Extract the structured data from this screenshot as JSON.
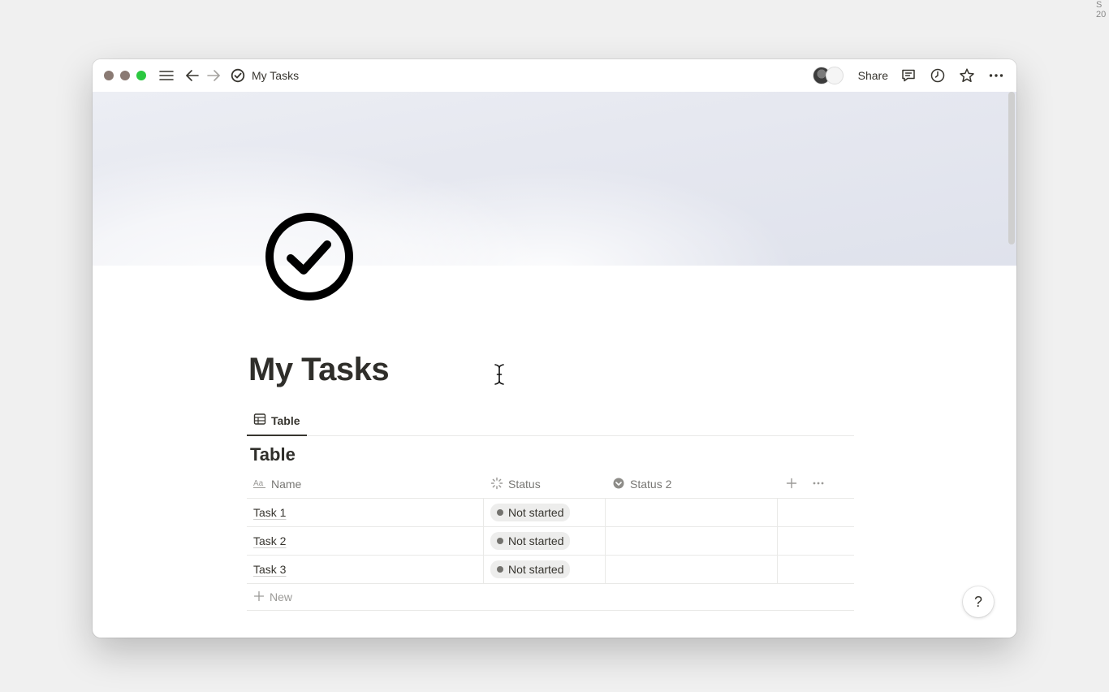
{
  "corner": {
    "text": "S 20"
  },
  "titlebar": {
    "breadcrumb": "My Tasks",
    "share_label": "Share"
  },
  "page": {
    "title": "My Tasks",
    "icon": "check-circle-icon"
  },
  "views": {
    "tabs": [
      {
        "label": "Table",
        "icon": "table-icon",
        "active": true
      }
    ]
  },
  "database": {
    "title": "Table",
    "columns": [
      {
        "label": "Name",
        "icon": "text-property-icon"
      },
      {
        "label": "Status",
        "icon": "status-loading-icon"
      },
      {
        "label": "Status 2",
        "icon": "status-circle-icon"
      }
    ],
    "rows": [
      {
        "name": "Task 1",
        "status": "Not started",
        "status2": ""
      },
      {
        "name": "Task 2",
        "status": "Not started",
        "status2": ""
      },
      {
        "name": "Task 3",
        "status": "Not started",
        "status2": ""
      }
    ],
    "new_label": "New"
  },
  "help": {
    "label": "?"
  },
  "colors": {
    "accent_green": "#2bc840",
    "text": "#37352f",
    "muted": "#787774",
    "pill_bg": "#ededec"
  }
}
